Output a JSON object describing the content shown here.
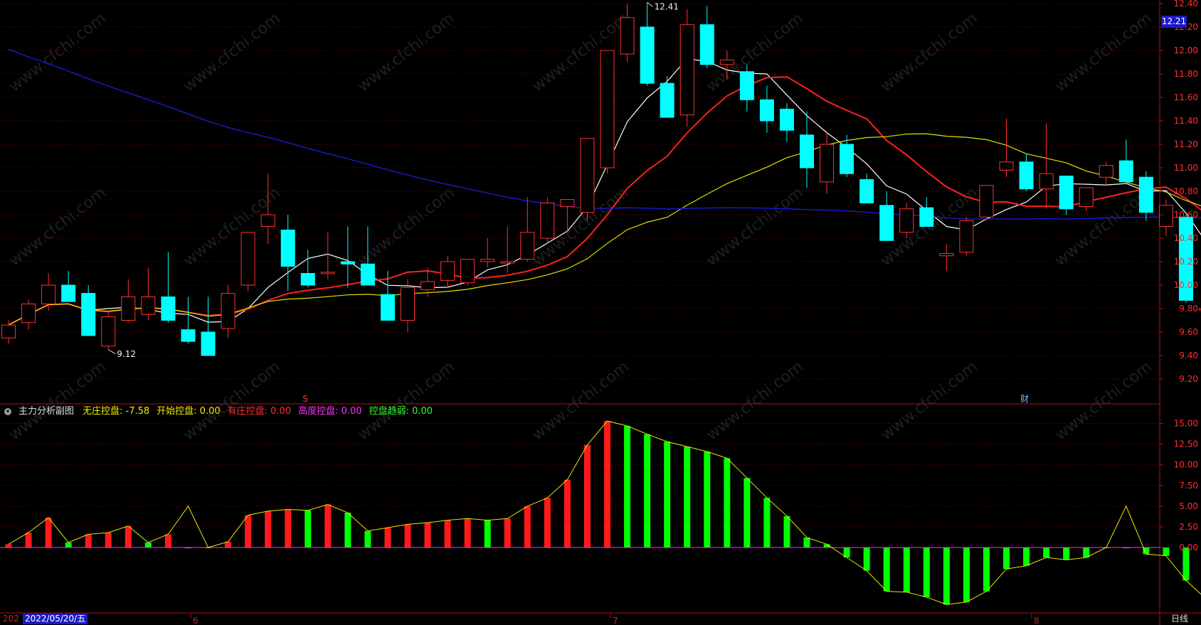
{
  "price_axis": {
    "ticks": [
      "12.40",
      "12.20",
      "12.00",
      "11.80",
      "11.60",
      "11.40",
      "11.20",
      "11.00",
      "10.80",
      "10.60",
      "10.40",
      "10.20",
      "10.00",
      "9.80",
      "9.60",
      "9.40",
      "9.20"
    ],
    "current_price": "12.21"
  },
  "annotations": {
    "high_label": "12.41",
    "low_label": "9.12",
    "marker_s": "S",
    "marker_cai": "财"
  },
  "indicator": {
    "name": "主力分析副图",
    "items": [
      {
        "label": "无庄控盘: -7.58",
        "color": "#f0f000"
      },
      {
        "label": "开始控盘: 0.00",
        "color": "#f0f000"
      },
      {
        "label": "有庄控盘: 0.00",
        "color": "#ff3030"
      },
      {
        "label": "高度控盘: 0.00",
        "color": "#ff30ff"
      },
      {
        "label": "控盘趋弱: 0.00",
        "color": "#30ff30"
      }
    ],
    "ticks": [
      "15.00",
      "12.50",
      "10.00",
      "7.50",
      "5.00",
      "2.50",
      "0.00"
    ]
  },
  "time_axis": {
    "date_prefix": "202",
    "current_date": "2022/05/20/五",
    "months": [
      "6",
      "7",
      "8"
    ],
    "period": "日线"
  },
  "watermark": "www.cfchi.com",
  "colors": {
    "up": "#ff3030",
    "down": "#00ffff",
    "ma5": "#ffffff",
    "ma10": "#ff2020",
    "ma20": "#e0e000",
    "ma60": "#1a1ad0",
    "bar_up": "#ff1a1a",
    "bar_down": "#00ff00",
    "grid": "#8b0000"
  },
  "chart_data": [
    {
      "type": "candlestick",
      "ylim": [
        9.1,
        12.41
      ],
      "series_names": [],
      "ohlc": [
        [
          9.55,
          9.7,
          9.5,
          9.66
        ],
        [
          9.68,
          9.88,
          9.62,
          9.84
        ],
        [
          9.84,
          10.1,
          9.78,
          10.0
        ],
        [
          10.0,
          10.12,
          9.9,
          9.86
        ],
        [
          9.93,
          10.0,
          9.62,
          9.57
        ],
        [
          9.48,
          9.78,
          9.45,
          9.73
        ],
        [
          9.7,
          10.05,
          9.68,
          9.9
        ],
        [
          9.75,
          10.15,
          9.7,
          9.9
        ],
        [
          9.9,
          10.28,
          9.68,
          9.7
        ],
        [
          9.62,
          9.9,
          9.5,
          9.52
        ],
        [
          9.6,
          9.9,
          9.5,
          9.4
        ],
        [
          9.63,
          10.0,
          9.55,
          9.93
        ],
        [
          10.0,
          10.35,
          9.95,
          10.45
        ],
        [
          10.5,
          10.95,
          10.35,
          10.6
        ],
        [
          10.47,
          10.6,
          9.95,
          10.16
        ],
        [
          10.1,
          10.3,
          9.98,
          10.0
        ],
        [
          10.1,
          10.45,
          10.05,
          10.11
        ],
        [
          10.2,
          10.5,
          9.98,
          10.18
        ],
        [
          10.18,
          10.5,
          10.1,
          10.0
        ],
        [
          9.92,
          10.12,
          9.82,
          9.7
        ],
        [
          9.7,
          10.05,
          9.6,
          9.98
        ],
        [
          9.96,
          10.15,
          9.9,
          10.03
        ],
        [
          10.04,
          10.25,
          9.98,
          10.2
        ],
        [
          10.02,
          10.22,
          10.0,
          10.22
        ],
        [
          10.2,
          10.4,
          10.15,
          10.22
        ],
        [
          10.2,
          10.5,
          10.1,
          10.2
        ],
        [
          10.22,
          10.75,
          10.2,
          10.45
        ],
        [
          10.4,
          10.75,
          10.35,
          10.7
        ],
        [
          10.67,
          10.72,
          10.45,
          10.73
        ],
        [
          10.62,
          11.0,
          10.55,
          11.25
        ],
        [
          11.0,
          11.55,
          10.95,
          12.0
        ],
        [
          11.97,
          12.4,
          11.9,
          12.28
        ],
        [
          12.2,
          12.41,
          11.7,
          11.72
        ],
        [
          11.72,
          11.78,
          11.6,
          11.43
        ],
        [
          11.45,
          12.35,
          11.35,
          12.22
        ],
        [
          12.22,
          12.38,
          11.85,
          11.88
        ],
        [
          11.88,
          12.0,
          11.75,
          11.92
        ],
        [
          11.82,
          11.88,
          11.48,
          11.58
        ],
        [
          11.58,
          11.7,
          11.3,
          11.4
        ],
        [
          11.5,
          11.55,
          11.22,
          11.32
        ],
        [
          11.28,
          11.48,
          10.83,
          11.0
        ],
        [
          10.88,
          11.3,
          10.78,
          11.2
        ],
        [
          11.2,
          11.28,
          10.92,
          10.95
        ],
        [
          10.9,
          10.95,
          10.72,
          10.7
        ],
        [
          10.68,
          10.8,
          10.38,
          10.38
        ],
        [
          10.45,
          10.7,
          10.4,
          10.65
        ],
        [
          10.66,
          10.75,
          10.52,
          10.5
        ],
        [
          10.25,
          10.35,
          10.12,
          10.27
        ],
        [
          10.28,
          10.58,
          10.25,
          10.55
        ],
        [
          10.58,
          10.85,
          10.55,
          10.85
        ],
        [
          10.98,
          11.42,
          10.92,
          11.05
        ],
        [
          11.05,
          11.12,
          10.8,
          10.82
        ],
        [
          10.82,
          11.38,
          10.65,
          10.95
        ],
        [
          10.93,
          10.92,
          10.6,
          10.65
        ],
        [
          10.67,
          10.8,
          10.63,
          10.83
        ],
        [
          10.92,
          11.05,
          10.85,
          11.02
        ],
        [
          11.06,
          11.24,
          10.9,
          10.88
        ],
        [
          10.92,
          10.97,
          10.55,
          10.62
        ],
        [
          10.5,
          10.73,
          10.42,
          10.68
        ],
        [
          10.58,
          10.6,
          9.85,
          9.87
        ],
        [
          9.79,
          10.16,
          9.72,
          9.8
        ],
        [
          9.93,
          10.03,
          9.79,
          9.78
        ]
      ]
    },
    {
      "type": "bar",
      "ylim": [
        -8.0,
        15.5
      ],
      "values": [
        0.4,
        1.8,
        3.6,
        0.6,
        1.6,
        1.8,
        2.6,
        0.6,
        1.6,
        0.0,
        0.0,
        0.7,
        3.9,
        4.4,
        4.6,
        4.5,
        5.2,
        4.2,
        2.0,
        2.4,
        2.8,
        3.0,
        3.3,
        3.5,
        3.3,
        3.5,
        5.0,
        6.0,
        8.2,
        12.4,
        15.3,
        14.7,
        13.7,
        12.8,
        12.2,
        11.6,
        10.8,
        8.4,
        6.0,
        3.8,
        1.2,
        0.4,
        -1.2,
        -2.8,
        -5.3,
        -5.4,
        -6.0,
        -6.9,
        -6.6,
        -5.3,
        -2.6,
        -2.2,
        -1.2,
        -1.5,
        -1.2,
        0.0,
        0.0,
        -0.8,
        -1.0,
        -4.0,
        -6.2,
        -7.58
      ],
      "line": [
        0.4,
        1.8,
        3.6,
        0.6,
        1.6,
        1.8,
        2.6,
        0.6,
        1.6,
        5.0,
        0.0,
        0.7,
        3.9,
        4.4,
        4.6,
        4.5,
        5.2,
        4.2,
        2.0,
        2.4,
        2.8,
        3.0,
        3.3,
        3.5,
        3.3,
        3.5,
        5.0,
        6.0,
        8.2,
        12.4,
        15.3,
        14.7,
        13.7,
        12.8,
        12.2,
        11.6,
        10.8,
        8.4,
        6.0,
        3.8,
        1.2,
        0.4,
        -1.2,
        -2.8,
        -5.3,
        -5.4,
        -6.0,
        -6.9,
        -6.6,
        -5.3,
        -2.6,
        -2.2,
        -1.2,
        -1.5,
        -1.2,
        0.0,
        5.0,
        -0.8,
        -1.0,
        -4.0,
        -6.2,
        -7.58
      ]
    }
  ]
}
